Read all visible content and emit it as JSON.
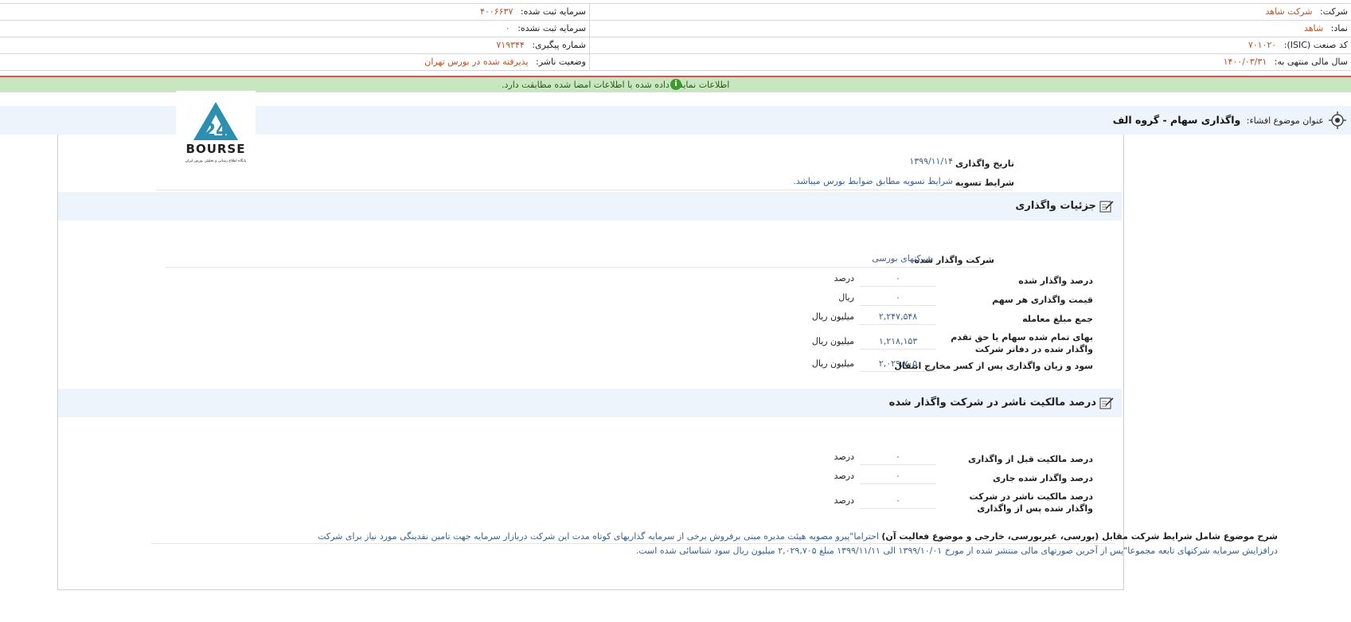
{
  "header": {
    "company_label": "شرکت:",
    "company_value": "شرکت شاهد",
    "symbol_label": "نماد:",
    "symbol_value": "شاهد",
    "isic_label": "کد صنعت (ISIC):",
    "isic_value": "۷۰۱۰۲۰",
    "fiscal_label": "سال مالی منتهی به:",
    "fiscal_value": "۱۴۰۰/۰۳/۳۱",
    "reg_capital_label": "سرمایه ثبت شده:",
    "reg_capital_value": "۴۰۰۶۶۳۷",
    "unreg_capital_label": "سرمایه ثبت نشده:",
    "unreg_capital_value": "۰",
    "tracking_label": "شماره پیگیری:",
    "tracking_value": "۷۱۹۳۴۴",
    "status_label": "وضعیت ناشر:",
    "status_value": "پذیرفته شده در بورس تهران"
  },
  "notice": {
    "text": "اطلاعات نمایش داده شده با اطلاعات امضا شده مطابقت دارد."
  },
  "title": {
    "label": "عنوان موضوع افشاء:",
    "value": "واگذاری سهام - گروه الف"
  },
  "logo": {
    "text": "BOURSE",
    "caption": "پایگاه اطلاع رسانی و تحلیلی بورس ایران",
    "number": "24"
  },
  "general": {
    "date_label": "تاریخ واگذاری",
    "date_value": "۱۳۹۹/۱۱/۱۴",
    "settle_label": "شرایط تسویه",
    "settle_value": "شرایط تسویه مطابق ضوابط بورس میباشد."
  },
  "details": {
    "title": "جزئیات واگذاری",
    "company_label": "شرکت واگذار شده",
    "company_value": "شرکتهای بورسی",
    "rows": [
      {
        "label": "درصد واگذار شده",
        "value": "۰",
        "unit": "درصد"
      },
      {
        "label": "قیمت واگذاری هر سهم",
        "value": "۰",
        "unit": "ریال"
      },
      {
        "label": "جمع مبلغ معامله",
        "value": "۲,۲۴۷,۵۴۸",
        "unit": "میلیون ریال"
      },
      {
        "label": "بهای تمام شده سهام یا حق تقدم واگذار شده در دفاتر شرکت",
        "value": "۱,۲۱۸,۱۵۳",
        "unit": "میلیون ریال"
      },
      {
        "label": "سود و زیان واگذاری پس از کسر مخارج انتقال",
        "value": "۲,۰۲۹,۷۰۵",
        "unit": "میلیون ریال"
      }
    ]
  },
  "ownership": {
    "title": "درصد مالکیت ناشر در شرکت واگذار شده",
    "rows": [
      {
        "label": "درصد مالکیت قبل از واگذاری",
        "value": "۰",
        "unit": "درصد"
      },
      {
        "label": "درصد واگذار شده جاری",
        "value": "۰",
        "unit": "درصد"
      },
      {
        "label": "درصد مالکیت ناشر در شرکت واگذار شده پس از واگذاری",
        "value": "۰",
        "unit": "درصد"
      }
    ]
  },
  "description": {
    "label": "شرح موضوع شامل شرایط شرکت مقابل (بورسی، غیربورسی، خارجی و موضوع فعالیت آن)",
    "value": "احتراما\"پیرو مصوبه هیئت مدیره مبنی برفروش برخی از سرمایه گذاریهای کوتاه مدت این شرکت دربازار سرمایه جهت تامین نقدینگی مورد نیاز برای شرکت درافزایش سرمایه شرکتهای تابعه مجموعا\"پس از آخرین صورتهای مالی منتشر شده از مورخ ۱۳۹۹/۱۰/۰۱ الی ۱۳۹۹/۱۱/۱۱ مبلغ ۲,۰۲۹,۷۰۵ میلیون ریال سود شناسائی شده است."
  }
}
